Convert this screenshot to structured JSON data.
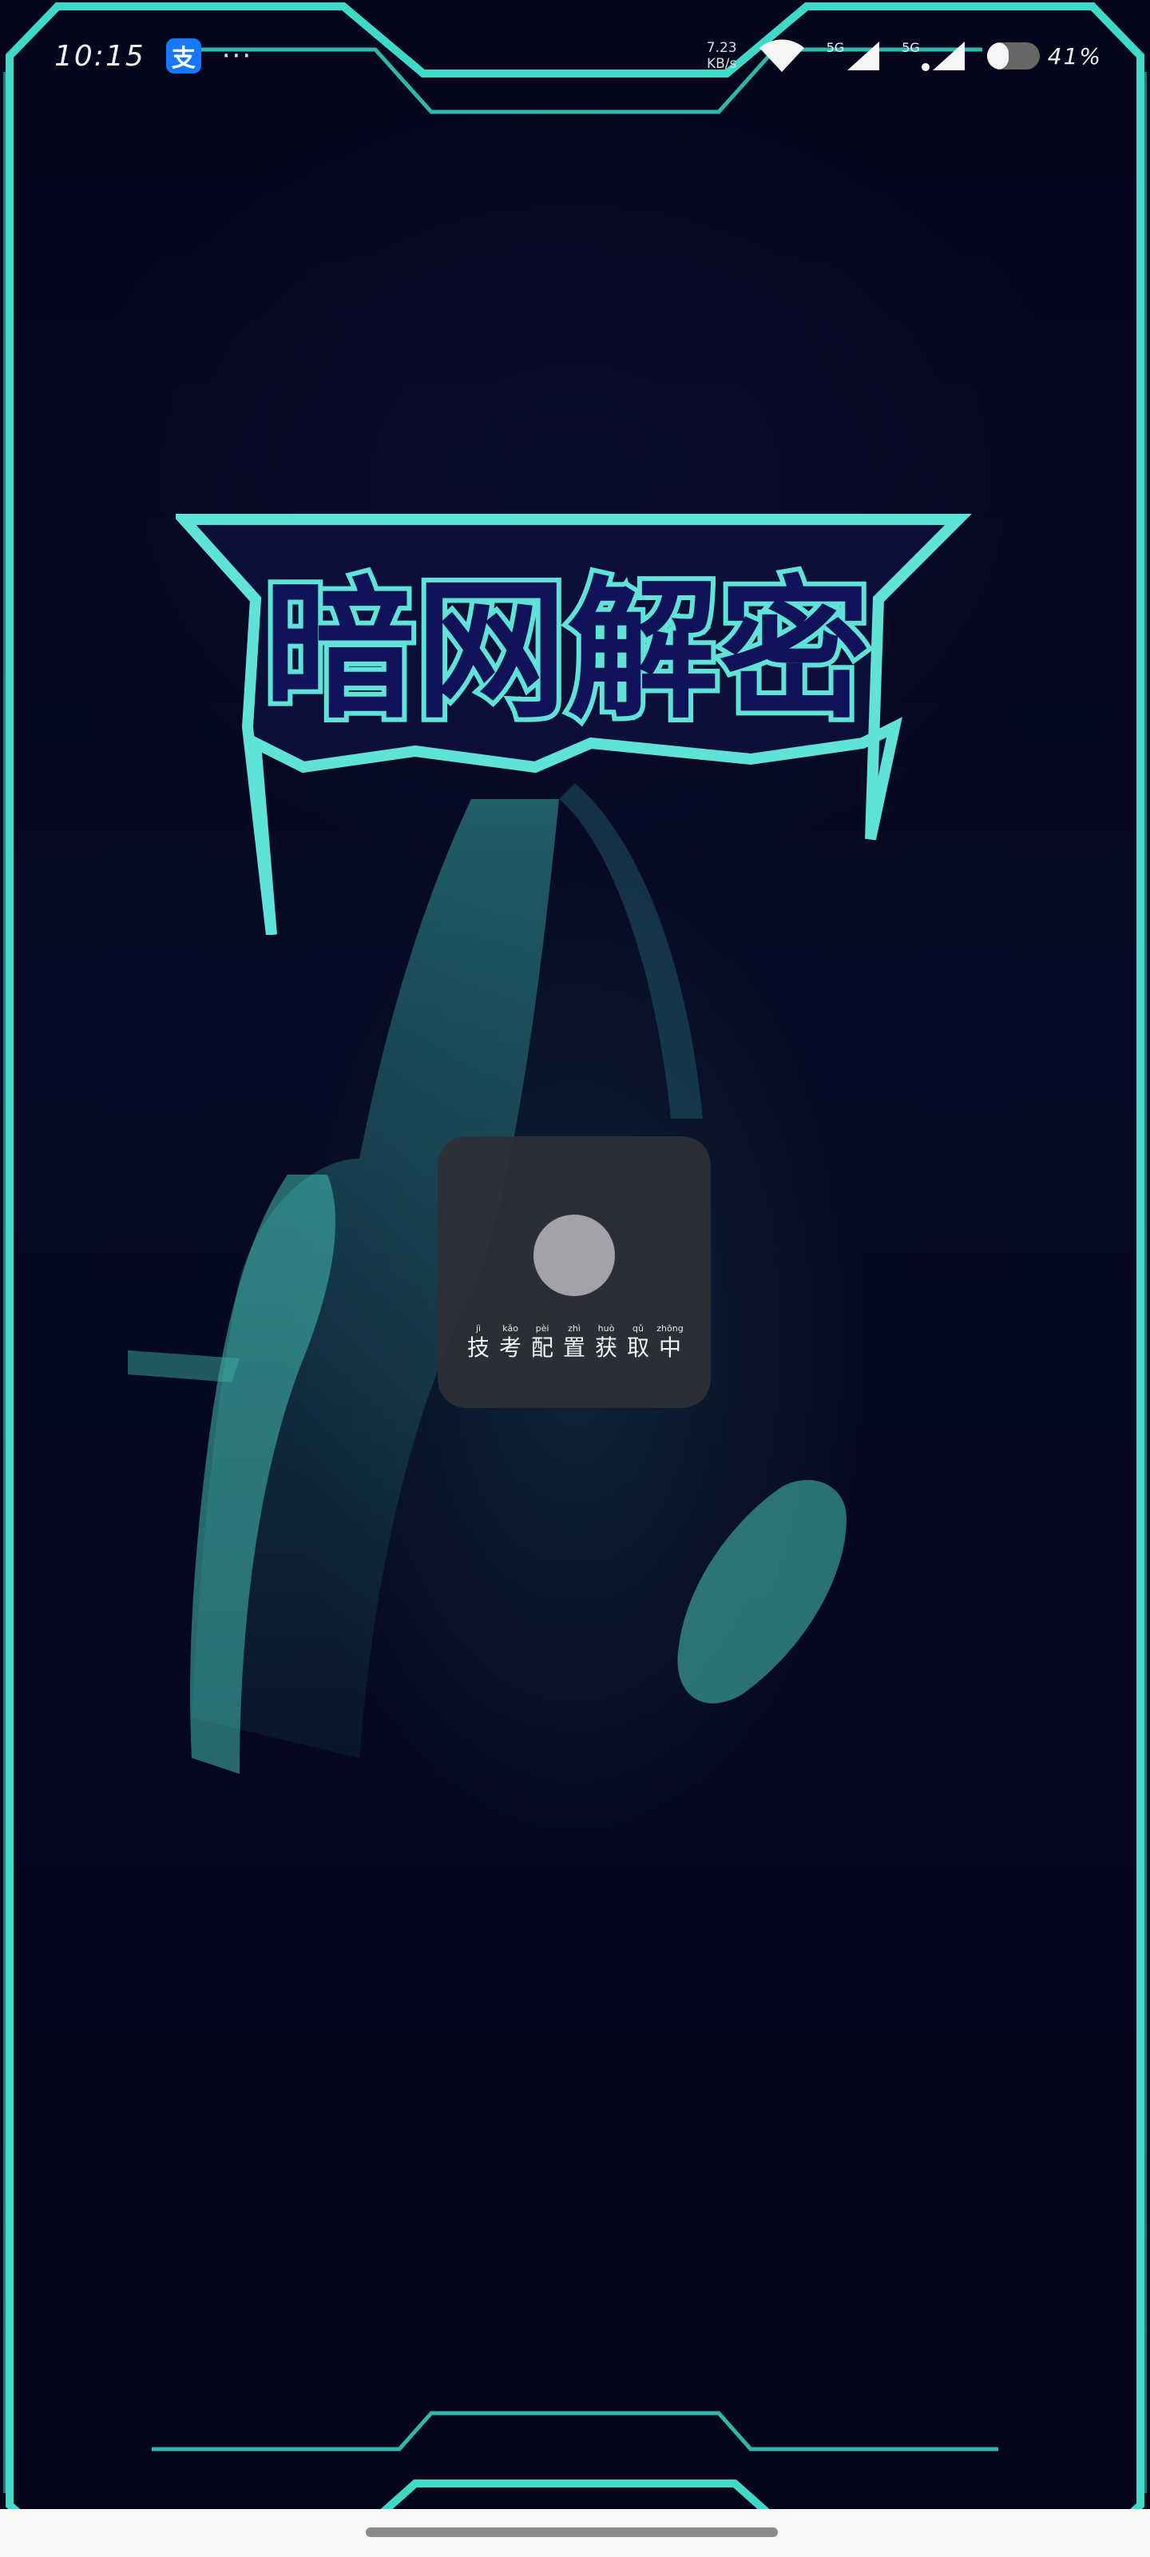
{
  "status_bar": {
    "time": "10:15",
    "app_icon_glyph": "支",
    "more_dots": "···",
    "net_speed_value": "7.23",
    "net_speed_unit": "KB/s",
    "signal1_label": "5G",
    "signal2_label": "5G",
    "battery_percent": 41,
    "battery_text": "41%"
  },
  "logo": {
    "title": "暗网解密",
    "color": "#5fe3d6"
  },
  "loading": {
    "chars": [
      {
        "pinyin": "jì",
        "hanzi": "技"
      },
      {
        "pinyin": "kǎo",
        "hanzi": "考"
      },
      {
        "pinyin": "pèi",
        "hanzi": "配"
      },
      {
        "pinyin": "zhì",
        "hanzi": "置"
      },
      {
        "pinyin": "huò",
        "hanzi": "获"
      },
      {
        "pinyin": "qǔ",
        "hanzi": "取"
      },
      {
        "pinyin": "zhōng",
        "hanzi": "中"
      }
    ]
  },
  "theme": {
    "frame_color": "#3fd9c8",
    "background": "#05051a"
  }
}
